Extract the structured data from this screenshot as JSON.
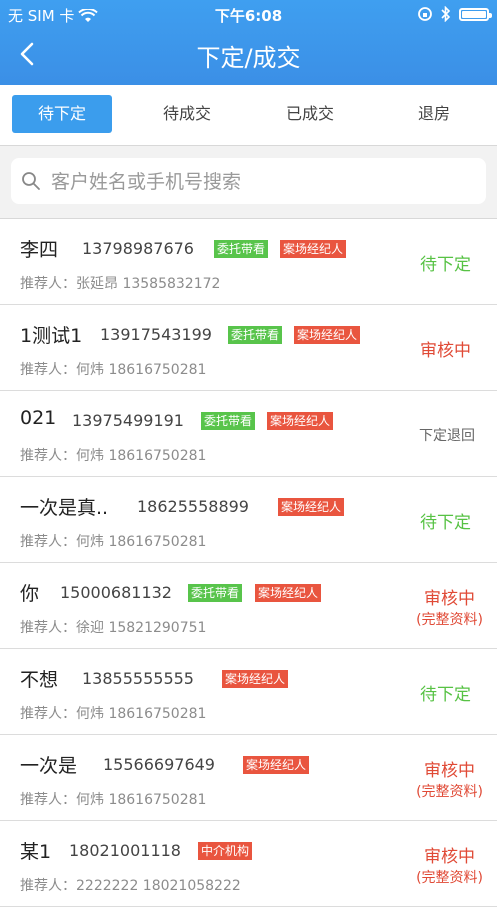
{
  "status_bar": {
    "carrier": "无 SIM 卡",
    "time": "下午6:08"
  },
  "nav": {
    "title": "下定/成交"
  },
  "tabs": [
    {
      "label": "待下定",
      "active": true
    },
    {
      "label": "待成交",
      "active": false
    },
    {
      "label": "已成交",
      "active": false
    },
    {
      "label": "退房",
      "active": false
    }
  ],
  "search": {
    "placeholder": "客户姓名或手机号搜索",
    "value": ""
  },
  "colors": {
    "header": "#3b8fe6",
    "tab_active": "#3b9ded",
    "tag_green": "#58c44b",
    "tag_red": "#e9553f",
    "status_green": "#57c244",
    "status_red": "#e04a36"
  },
  "rows": [
    {
      "name": "李四",
      "phone": "13798987676",
      "tags": [
        "委托带看",
        "案场经纪人"
      ],
      "ref_label": "推荐人：",
      "ref": "张延昂 13585832172",
      "status": "待下定",
      "status_sub": ""
    },
    {
      "name": "1测试1",
      "phone": "13917543199",
      "tags": [
        "委托带看",
        "案场经纪人"
      ],
      "ref_label": "推荐人：",
      "ref": "何炜 18616750281",
      "status": "审核中",
      "status_sub": ""
    },
    {
      "name": "021",
      "phone": "13975499191",
      "tags": [
        "委托带看",
        "案场经纪人"
      ],
      "ref_label": "推荐人：",
      "ref": "何炜 18616750281",
      "status": "下定退回",
      "status_sub": ""
    },
    {
      "name": "一次是真..",
      "phone": "18625558899",
      "tags": [
        "案场经纪人"
      ],
      "ref_label": "推荐人：",
      "ref": "何炜 18616750281",
      "status": "待下定",
      "status_sub": ""
    },
    {
      "name": "你",
      "phone": "15000681132",
      "tags": [
        "委托带看",
        "案场经纪人"
      ],
      "ref_label": "推荐人：",
      "ref": "徐迎 15821290751",
      "status": "审核中",
      "status_sub": "(完整资料)"
    },
    {
      "name": "不想",
      "phone": "13855555555",
      "tags": [
        "案场经纪人"
      ],
      "ref_label": "推荐人：",
      "ref": "何炜 18616750281",
      "status": "待下定",
      "status_sub": ""
    },
    {
      "name": "一次是",
      "phone": "15566697649",
      "tags": [
        "案场经纪人"
      ],
      "ref_label": "推荐人：",
      "ref": "何炜 18616750281",
      "status": "审核中",
      "status_sub": "(完整资料)"
    },
    {
      "name": "某1",
      "phone": "18021001118",
      "tags": [
        "中介机构"
      ],
      "ref_label": "推荐人：",
      "ref": "2222222 18021058222",
      "status": "审核中",
      "status_sub": "(完整资料)"
    }
  ]
}
